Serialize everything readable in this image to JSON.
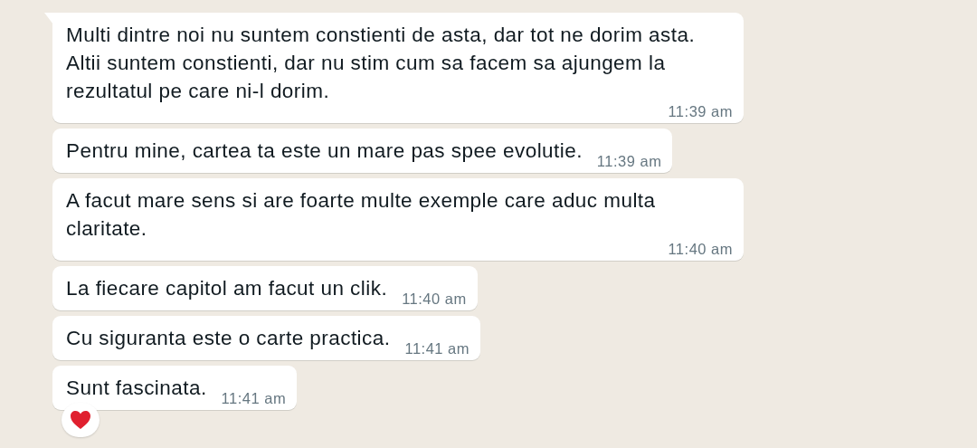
{
  "messages": [
    {
      "text": "Multi dintre noi nu suntem constienti de asta, dar tot ne dorim asta. Altii suntem constienti, dar nu stim cum sa facem sa ajungem la rezultatul pe care ni-l dorim.",
      "time": "11:39 am",
      "tail": true,
      "reacted": false
    },
    {
      "text": "Pentru mine, cartea ta este un mare pas spee evolutie.",
      "time": "11:39 am",
      "tail": false,
      "reacted": false
    },
    {
      "text": "A facut mare sens si are foarte multe exemple care aduc multa claritate.",
      "time": "11:40 am",
      "tail": false,
      "reacted": false
    },
    {
      "text": "La fiecare capitol am facut un clik.",
      "time": "11:40 am",
      "tail": false,
      "reacted": false
    },
    {
      "text": "Cu siguranta este o carte practica.",
      "time": "11:41 am",
      "tail": false,
      "reacted": false
    },
    {
      "text": "Sunt fascinata.",
      "time": "11:41 am",
      "tail": false,
      "reacted": true
    }
  ]
}
